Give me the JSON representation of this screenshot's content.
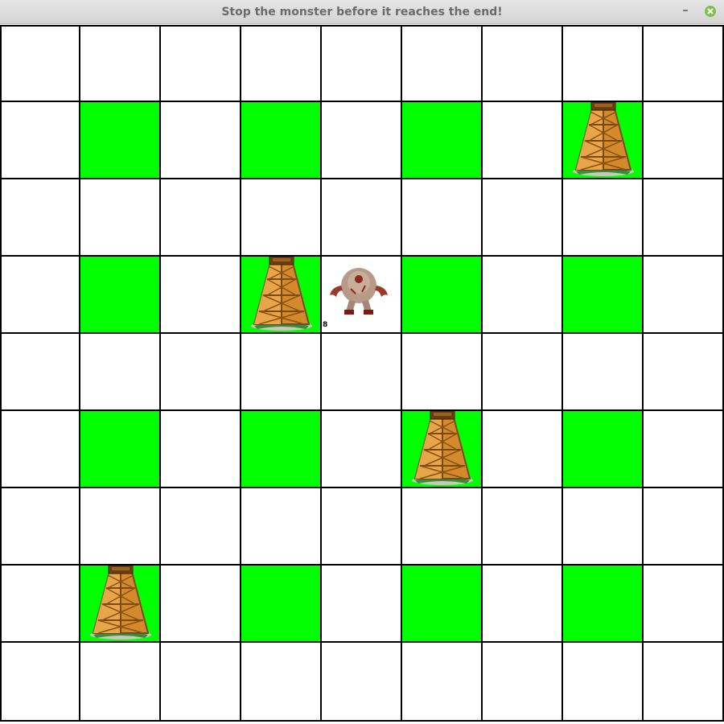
{
  "window": {
    "title": "Stop the monster before it reaches the end!",
    "minimize_label": "–"
  },
  "board": {
    "rows": 9,
    "cols": 9,
    "green_color": "#00ff00",
    "empty_color": "#ffffff",
    "green_cells": [
      [
        1,
        1
      ],
      [
        1,
        3
      ],
      [
        1,
        5
      ],
      [
        1,
        7
      ],
      [
        3,
        1
      ],
      [
        3,
        3
      ],
      [
        3,
        5
      ],
      [
        3,
        7
      ],
      [
        5,
        1
      ],
      [
        5,
        3
      ],
      [
        5,
        5
      ],
      [
        5,
        7
      ],
      [
        7,
        1
      ],
      [
        7,
        3
      ],
      [
        7,
        5
      ],
      [
        7,
        7
      ]
    ],
    "towers": [
      [
        1,
        7
      ],
      [
        3,
        3
      ],
      [
        5,
        5
      ],
      [
        7,
        1
      ]
    ],
    "monster": {
      "row": 3,
      "col": 4,
      "health": "8"
    }
  }
}
